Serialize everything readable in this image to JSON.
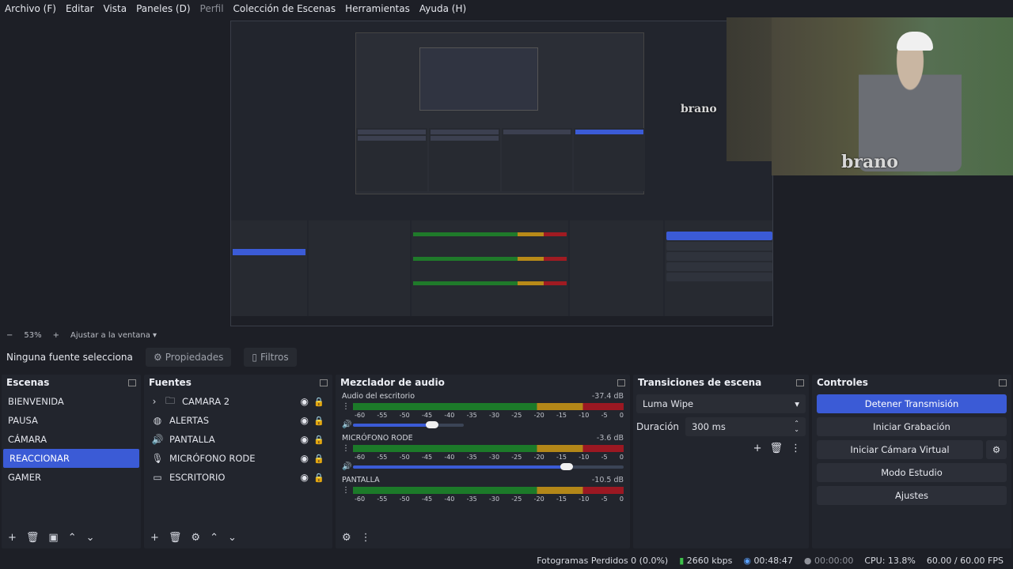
{
  "menu": {
    "items": [
      "Archivo (F)",
      "Editar",
      "Vista",
      "Paneles (D)",
      "Perfil",
      "Colección de Escenas",
      "Herramientas",
      "Ayuda (H)"
    ]
  },
  "overlay": {
    "logo_text": "brano"
  },
  "zoom": {
    "minus": "−",
    "value": "53%",
    "plus": "+",
    "fit_label": "Ajustar a la ventana"
  },
  "source_bar": {
    "label": "Ninguna fuente selecciona",
    "properties": "Propiedades",
    "filters": "Filtros"
  },
  "scenes": {
    "title": "Escenas",
    "items": [
      "BIENVENIDA",
      "PAUSA",
      "CÁMARA",
      "REACCIONAR",
      "GAMER"
    ],
    "selected_index": 3
  },
  "sources": {
    "title": "Fuentes",
    "items": [
      {
        "label": "CAMARA 2",
        "icon": "folder-icon"
      },
      {
        "label": "ALERTAS",
        "icon": "globe-icon"
      },
      {
        "label": "PANTALLA",
        "icon": "speaker-icon"
      },
      {
        "label": "MICRÓFONO RODE",
        "icon": "microphone-icon"
      },
      {
        "label": "ESCRITORIO",
        "icon": "monitor-icon"
      }
    ]
  },
  "mixer": {
    "title": "Mezclador de audio",
    "ticks": [
      "-60",
      "-55",
      "-50",
      "-45",
      "-40",
      "-35",
      "-30",
      "-25",
      "-20",
      "-15",
      "-10",
      "-5",
      "0"
    ],
    "channels": [
      {
        "name": "Audio del escritorio",
        "db": "-37.4 dB",
        "volume": 0.82
      },
      {
        "name": "MICRÓFONO RODE",
        "db": "-3.6 dB",
        "volume": 0.82
      },
      {
        "name": "PANTALLA",
        "db": "-10.5 dB",
        "volume": null
      }
    ]
  },
  "transitions": {
    "title": "Transiciones de escena",
    "selected": "Luma Wipe",
    "duration_label": "Duración",
    "duration_value": "300 ms"
  },
  "controls": {
    "title": "Controles",
    "buttons": [
      "Detener Transmisión",
      "Iniciar Grabación",
      "Iniciar Cámara Virtual",
      "Modo Estudio",
      "Ajustes"
    ]
  },
  "status": {
    "dropped": "Fotogramas Perdidos 0 (0.0%)",
    "bitrate": "2660 kbps",
    "stream_time": "00:48:47",
    "rec_time": "00:00:00",
    "cpu": "CPU: 13.8%",
    "fps": "60.00 / 60.00 FPS"
  },
  "colors": {
    "accent": "#3b5bd6",
    "bg": "#1d1f26",
    "panel": "#22252d"
  }
}
